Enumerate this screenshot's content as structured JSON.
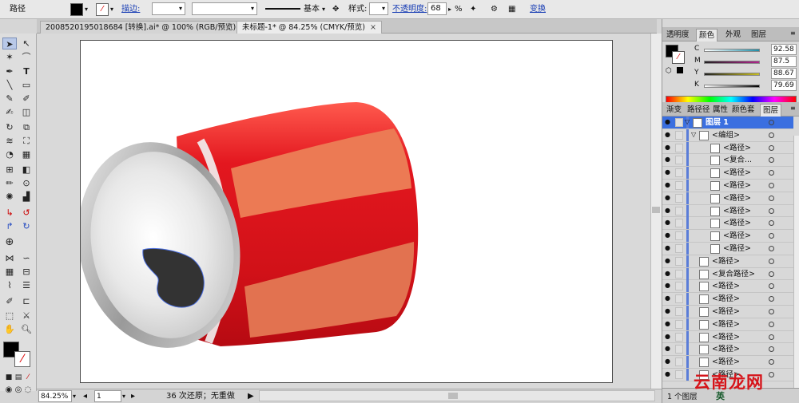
{
  "control_bar": {
    "object_type": "路径",
    "stroke_label": "描边:",
    "brush_label": "基本",
    "style_label": "样式:",
    "opacity_label": "不透明度:",
    "opacity_value": "68",
    "opacity_unit": "%",
    "transform_label": "变换"
  },
  "document_tabs": [
    {
      "label": "2008520195018684 [转换].ai* @ 100% (RGB/预览)",
      "close": "×",
      "active": false
    },
    {
      "label": "未标题-1* @ 84.25% (CMYK/预览)",
      "close": "×",
      "active": true
    }
  ],
  "status_bar": {
    "zoom": "84.25%",
    "page": "1",
    "status_text": "36 次还原；无重做"
  },
  "color_panel": {
    "tabs": [
      "透明度",
      "颜色",
      "外观",
      "图层"
    ],
    "active_tab": "颜色",
    "channels": [
      {
        "label": "C",
        "value": "92.58",
        "color": "#1e8ea8"
      },
      {
        "label": "M",
        "value": "87.5",
        "color": "#b0248c"
      },
      {
        "label": "Y",
        "value": "88.67",
        "color": "#c9bf20"
      },
      {
        "label": "K",
        "value": "79.69",
        "color": "#222222"
      }
    ]
  },
  "layers_panel": {
    "tabs": [
      "渐变",
      "路径径",
      "属性",
      "颜色套",
      "图层"
    ],
    "active_tab": "图层",
    "rows": [
      {
        "name": "图层 1",
        "level": 0,
        "highlight": true
      },
      {
        "name": "<编组>",
        "level": 1
      },
      {
        "name": "<路径>",
        "level": 2
      },
      {
        "name": "<复合...",
        "level": 2
      },
      {
        "name": "<路径>",
        "level": 2
      },
      {
        "name": "<路径>",
        "level": 2
      },
      {
        "name": "<路径>",
        "level": 2
      },
      {
        "name": "<路径>",
        "level": 2
      },
      {
        "name": "<路径>",
        "level": 2
      },
      {
        "name": "<路径>",
        "level": 2
      },
      {
        "name": "<路径>",
        "level": 2
      },
      {
        "name": "<路径>",
        "level": 1
      },
      {
        "name": "<复合路径>",
        "level": 1
      },
      {
        "name": "<路径>",
        "level": 1
      },
      {
        "name": "<路径>",
        "level": 1
      },
      {
        "name": "<路径>",
        "level": 1
      },
      {
        "name": "<路径>",
        "level": 1
      },
      {
        "name": "<路径>",
        "level": 1
      },
      {
        "name": "<路径>",
        "level": 1
      },
      {
        "name": "<路径>",
        "level": 1
      },
      {
        "name": "<路径>",
        "level": 1
      }
    ],
    "footer_label": "1 个图层"
  },
  "watermark": {
    "text": "云南龙网",
    "sub": "英"
  },
  "colors": {
    "highlight": "#3a6fe0",
    "can_red": "#e3171f",
    "can_stripe": "#ee7a50"
  }
}
